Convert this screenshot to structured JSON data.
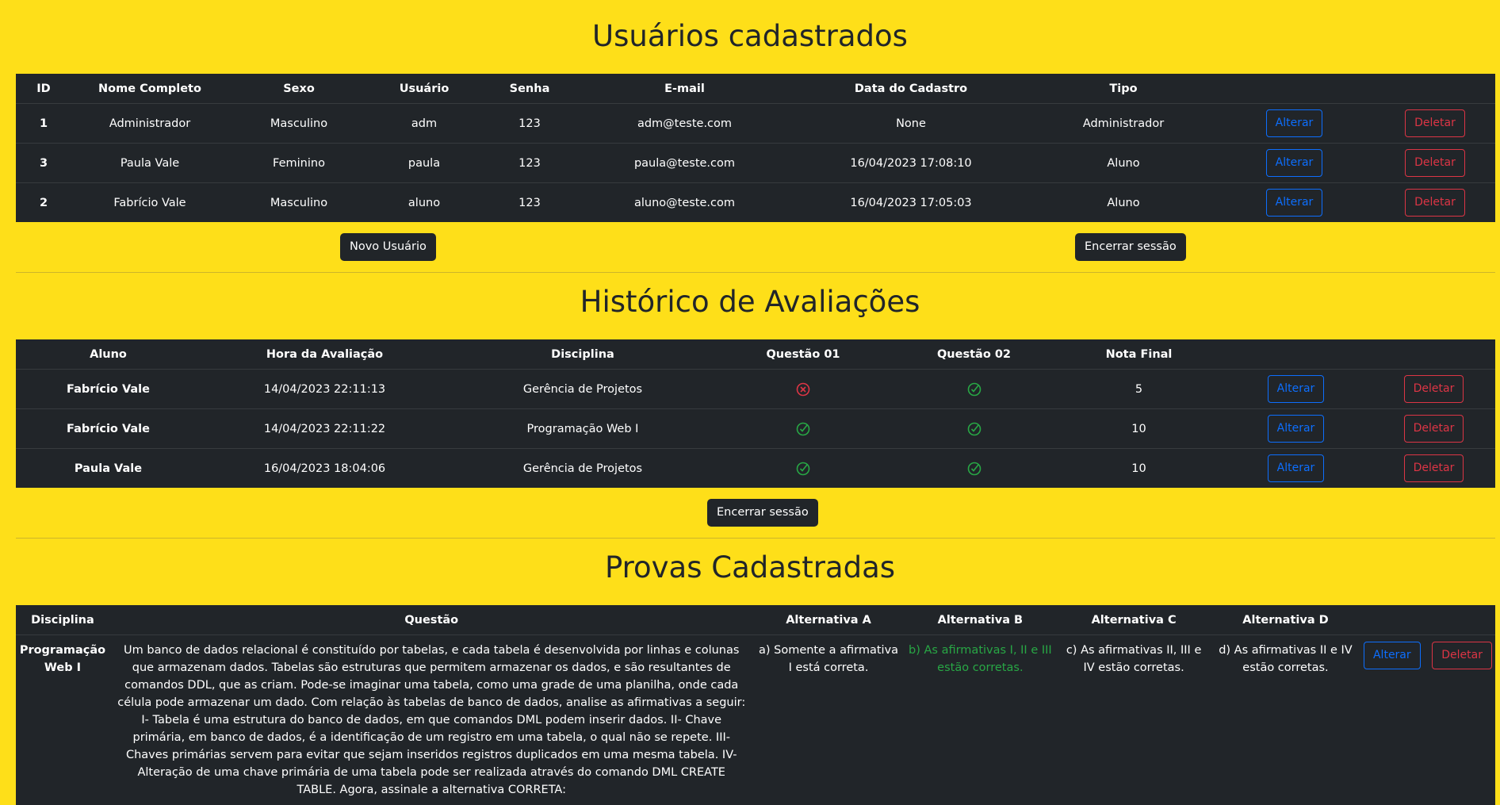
{
  "users": {
    "title": "Usuários cadastrados",
    "headers": [
      "ID",
      "Nome Completo",
      "Sexo",
      "Usuário",
      "Senha",
      "E-mail",
      "Data do Cadastro",
      "Tipo"
    ],
    "rows": [
      {
        "id": "1",
        "nome": "Administrador",
        "sexo": "Masculino",
        "usuario": "adm",
        "senha": "123",
        "email": "adm@teste.com",
        "data": "None",
        "tipo": "Administrador"
      },
      {
        "id": "3",
        "nome": "Paula Vale",
        "sexo": "Feminino",
        "usuario": "paula",
        "senha": "123",
        "email": "paula@teste.com",
        "data": "16/04/2023 17:08:10",
        "tipo": "Aluno"
      },
      {
        "id": "2",
        "nome": "Fabrício Vale",
        "sexo": "Masculino",
        "usuario": "aluno",
        "senha": "123",
        "email": "aluno@teste.com",
        "data": "16/04/2023 17:05:03",
        "tipo": "Aluno"
      }
    ],
    "alter_label": "Alterar",
    "delete_label": "Deletar",
    "new_user_label": "Novo Usuário",
    "logout_label": "Encerrar sessão"
  },
  "history": {
    "title": "Histórico de Avaliações",
    "headers": [
      "Aluno",
      "Hora da Avaliação",
      "Disciplina",
      "Questão 01",
      "Questão 02",
      "Nota Final"
    ],
    "rows": [
      {
        "aluno": "Fabrício Vale",
        "hora": "14/04/2023 22:11:13",
        "disciplina": "Gerência de Projetos",
        "q1": "wrong-icon",
        "q2": "check-icon",
        "nota": "5"
      },
      {
        "aluno": "Fabrício Vale",
        "hora": "14/04/2023 22:11:22",
        "disciplina": "Programação Web I",
        "q1": "check-icon",
        "q2": "check-icon",
        "nota": "10"
      },
      {
        "aluno": "Paula Vale",
        "hora": "16/04/2023 18:04:06",
        "disciplina": "Gerência de Projetos",
        "q1": "check-icon",
        "q2": "check-icon",
        "nota": "10"
      }
    ],
    "alter_label": "Alterar",
    "delete_label": "Deletar",
    "logout_label": "Encerrar sessão"
  },
  "exams": {
    "title": "Provas Cadastradas",
    "headers": [
      "Disciplina",
      "Questão",
      "Alternativa A",
      "Alternativa B",
      "Alternativa C",
      "Alternativa D"
    ],
    "rows": [
      {
        "disciplina": "Programação Web I",
        "questao": "Um banco de dados relacional é constituído por tabelas, e cada tabela é desenvolvida por linhas e colunas que armazenam dados. Tabelas são estruturas que permitem armazenar os dados, e são resultantes de comandos DDL, que as criam. Pode-se imaginar uma tabela, como uma grade de uma planilha, onde cada célula pode armazenar um dado. Com relação às tabelas de banco de dados, analise as afirmativas a seguir: I- Tabela é uma estrutura do banco de dados, em que comandos DML podem inserir dados. II- Chave primária, em banco de dados, é a identificação de um registro em uma tabela, o qual não se repete. III- Chaves primárias servem para evitar que sejam inseridos registros duplicados em uma mesma tabela. IV- Alteração de uma chave primária de uma tabela pode ser realizada através do comando DML CREATE TABLE. Agora, assinale a alternativa CORRETA:",
        "alt_a": "a) Somente a afirmativa I está correta.",
        "alt_b": "b) As afirmativas I, II e III estão corretas.",
        "alt_c": "c) As afirmativas II, III e IV estão corretas.",
        "alt_d": "d) As afirmativas II e IV estão corretas."
      }
    ],
    "alter_label": "Alterar",
    "delete_label": "Deletar"
  },
  "colors": {
    "background": "#fedf19",
    "table": "#212529",
    "primary": "#0d6efd",
    "danger": "#dc3545",
    "success": "#28a745"
  }
}
